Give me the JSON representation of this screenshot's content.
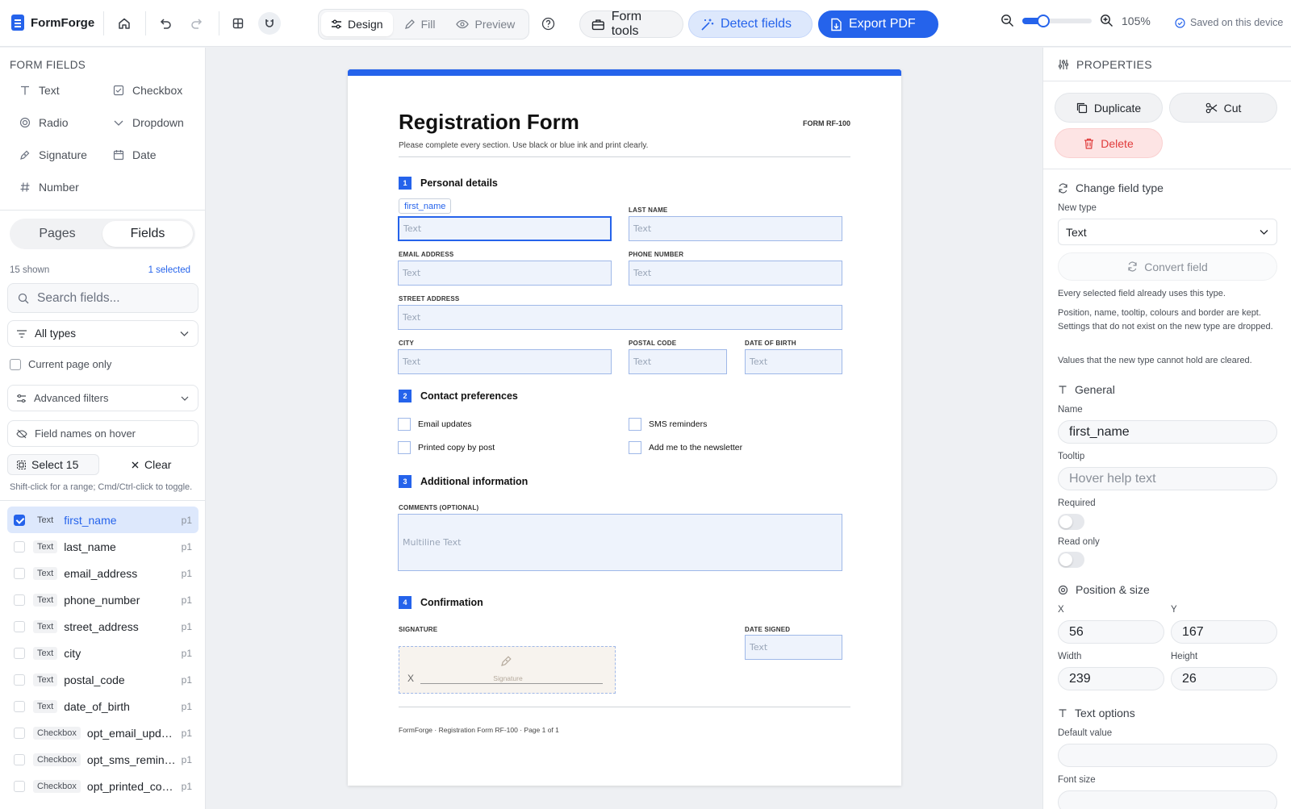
{
  "app": {
    "name": "FormForge",
    "saved_status": "Saved on this device",
    "zoom": "105%",
    "zoom_level": 0.3
  },
  "toolbar": {
    "modes": [
      {
        "label": "Design",
        "active": true
      },
      {
        "label": "Fill",
        "active": false
      },
      {
        "label": "Preview",
        "active": false
      }
    ],
    "form_tools": "Form tools",
    "detect_fields": "Detect fields",
    "export_pdf": "Export PDF"
  },
  "left": {
    "section_title": "FORM FIELDS",
    "tools": [
      "Text",
      "Checkbox",
      "Radio",
      "Dropdown",
      "Signature",
      "Date",
      "Number"
    ],
    "tabs": [
      "Pages",
      "Fields"
    ],
    "shown": "15 shown",
    "selected": "1 selected",
    "search_placeholder": "Search fields...",
    "type_filter": "All types",
    "current_page_only": "Current page only",
    "advanced_filters": "Advanced filters",
    "names_on_hover": "Field names on hover",
    "select_all": "Select 15",
    "clear": "Clear",
    "hint": "Shift-click for a range; Cmd/Ctrl-click to toggle.",
    "fields": [
      {
        "type": "Text",
        "name": "first_name",
        "page": "p1",
        "selected": true
      },
      {
        "type": "Text",
        "name": "last_name",
        "page": "p1",
        "selected": false
      },
      {
        "type": "Text",
        "name": "email_address",
        "page": "p1",
        "selected": false
      },
      {
        "type": "Text",
        "name": "phone_number",
        "page": "p1",
        "selected": false
      },
      {
        "type": "Text",
        "name": "street_address",
        "page": "p1",
        "selected": false
      },
      {
        "type": "Text",
        "name": "city",
        "page": "p1",
        "selected": false
      },
      {
        "type": "Text",
        "name": "postal_code",
        "page": "p1",
        "selected": false
      },
      {
        "type": "Text",
        "name": "date_of_birth",
        "page": "p1",
        "selected": false
      },
      {
        "type": "Checkbox",
        "name": "opt_email_upd…",
        "page": "p1",
        "selected": false
      },
      {
        "type": "Checkbox",
        "name": "opt_sms_remin…",
        "page": "p1",
        "selected": false
      },
      {
        "type": "Checkbox",
        "name": "opt_printed_co…",
        "page": "p1",
        "selected": false
      }
    ]
  },
  "document": {
    "title": "Registration Form",
    "form_no": "FORM RF-100",
    "subtitle": "Please complete every section. Use black or blue ink and print clearly.",
    "selected_tag": "first_name",
    "placeholder_text": "Text",
    "placeholder_multiline": "Multiline Text",
    "sections": [
      {
        "num": "1",
        "title": "Personal details"
      },
      {
        "num": "2",
        "title": "Contact preferences"
      },
      {
        "num": "3",
        "title": "Additional information"
      },
      {
        "num": "4",
        "title": "Confirmation"
      }
    ],
    "labels": {
      "last_name": "LAST NAME",
      "email": "EMAIL ADDRESS",
      "phone": "PHONE NUMBER",
      "street": "STREET ADDRESS",
      "city": "CITY",
      "postal": "POSTAL CODE",
      "dob": "DATE OF BIRTH",
      "comments": "COMMENTS (OPTIONAL)",
      "signature": "SIGNATURE",
      "date_signed": "DATE SIGNED"
    },
    "checkboxes": [
      "Email updates",
      "SMS reminders",
      "Printed copy by post",
      "Add me to the newsletter"
    ],
    "signature_x": "X",
    "signature_placeholder": "Signature",
    "footer": "FormForge · Registration Form RF-100 · Page 1 of 1"
  },
  "properties": {
    "title": "PROPERTIES",
    "duplicate": "Duplicate",
    "cut": "Cut",
    "delete": "Delete",
    "change_type_title": "Change field type",
    "new_type_label": "New type",
    "new_type_value": "Text",
    "convert": "Convert field",
    "note1": "Every selected field already uses this type.",
    "note2": "Position, name, tooltip, colours and border are kept. Settings that do not exist on the new type are dropped.",
    "note3": "Values that the new type cannot hold are cleared.",
    "general_title": "General",
    "name_label": "Name",
    "name_value": "first_name",
    "tooltip_label": "Tooltip",
    "tooltip_placeholder": "Hover help text",
    "required_label": "Required",
    "readonly_label": "Read only",
    "position_title": "Position & size",
    "x_label": "X",
    "x_value": "56",
    "y_label": "Y",
    "y_value": "167",
    "width_label": "Width",
    "width_value": "239",
    "height_label": "Height",
    "height_value": "26",
    "text_options_title": "Text options",
    "default_value_label": "Default value",
    "font_size_label": "Font size"
  }
}
